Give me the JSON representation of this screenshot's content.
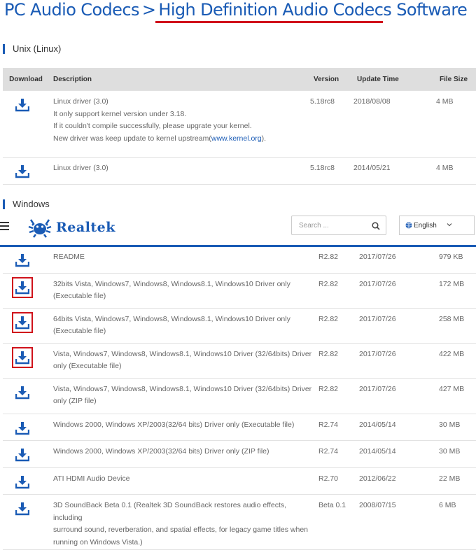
{
  "title": {
    "category": "PC Audio Codecs",
    "separator": ">",
    "page": "High Definition Audio Codecs Software"
  },
  "unix_section": {
    "heading": "Unix (Linux)",
    "columns": [
      "Download",
      "Description",
      "Version",
      "Update Time",
      "File Size"
    ],
    "rows": [
      {
        "desc_lines": [
          "Linux driver (3.0)",
          "It only support kernel version under 3.18.",
          "If it couldn't compile successfully, please upgrate your kernel."
        ],
        "last_line_pre": "New driver was keep update to kernel upstream(",
        "last_line_link": "www.kernel.org",
        "last_line_post": ").",
        "version": "5.18rc8",
        "date": "2018/08/08",
        "size": "4 MB"
      },
      {
        "desc_lines": [
          "Linux driver (3.0)"
        ],
        "version": "5.18rc8",
        "date": "2014/05/21",
        "size": "4 MB"
      }
    ]
  },
  "windows_section": {
    "heading": "Windows",
    "rows": [
      {
        "desc": [
          "README"
        ],
        "version": "R2.82",
        "date": "2017/07/26",
        "size": "979 KB",
        "highlighted": false
      },
      {
        "desc": [
          "32bits Vista, Windows7, Windows8, Windows8.1, Windows10 Driver only",
          "(Executable file)"
        ],
        "version": "R2.82",
        "date": "2017/07/26",
        "size": "172 MB",
        "highlighted": true
      },
      {
        "desc": [
          "64bits Vista, Windows7, Windows8, Windows8.1, Windows10 Driver only",
          "(Executable file)"
        ],
        "version": "R2.82",
        "date": "2017/07/26",
        "size": "258 MB",
        "highlighted": true
      },
      {
        "desc": [
          "Vista, Windows7, Windows8, Windows8.1, Windows10 Driver (32/64bits) Driver",
          "only (Executable file)"
        ],
        "version": "R2.82",
        "date": "2017/07/26",
        "size": "422 MB",
        "highlighted": true
      },
      {
        "desc": [
          "Vista, Windows7, Windows8, Windows8.1, Windows10 Driver (32/64bits) Driver",
          "only (ZIP file)"
        ],
        "version": "R2.82",
        "date": "2017/07/26",
        "size": "427 MB",
        "highlighted": false
      },
      {
        "desc": [
          "Windows 2000, Windows XP/2003(32/64 bits) Driver only (Executable file)"
        ],
        "version": "R2.74",
        "date": "2014/05/14",
        "size": "30 MB",
        "highlighted": false
      },
      {
        "desc": [
          "Windows 2000, Windows XP/2003(32/64 bits) Driver only (ZIP file)"
        ],
        "version": "R2.74",
        "date": "2014/05/14",
        "size": "30 MB",
        "highlighted": false
      },
      {
        "desc": [
          "ATI HDMI Audio Device"
        ],
        "version": "R2.70",
        "date": "2012/06/22",
        "size": "22 MB",
        "highlighted": false
      },
      {
        "desc": [
          "3D SoundBack Beta 0.1 (Realtek 3D SoundBack restores audio effects, including",
          "surround sound, reverberation, and spatial effects, for legacy game titles when",
          "running on Windows Vista.)"
        ],
        "version": "Beta 0.1",
        "date": "2008/07/15",
        "size": "6 MB",
        "highlighted": false
      }
    ]
  },
  "header": {
    "logo_text": "Realtek",
    "search_placeholder": "Search ...",
    "language": "English",
    "icons": {
      "menu": "hamburger-menu-icon",
      "search": "search-icon",
      "globe": "globe-icon",
      "chevron": "chevron-down-icon",
      "download": "download-icon"
    }
  },
  "colors": {
    "brand_blue": "#1a5bb5",
    "highlight_red": "#d0121b",
    "header_gray": "#dedede"
  }
}
